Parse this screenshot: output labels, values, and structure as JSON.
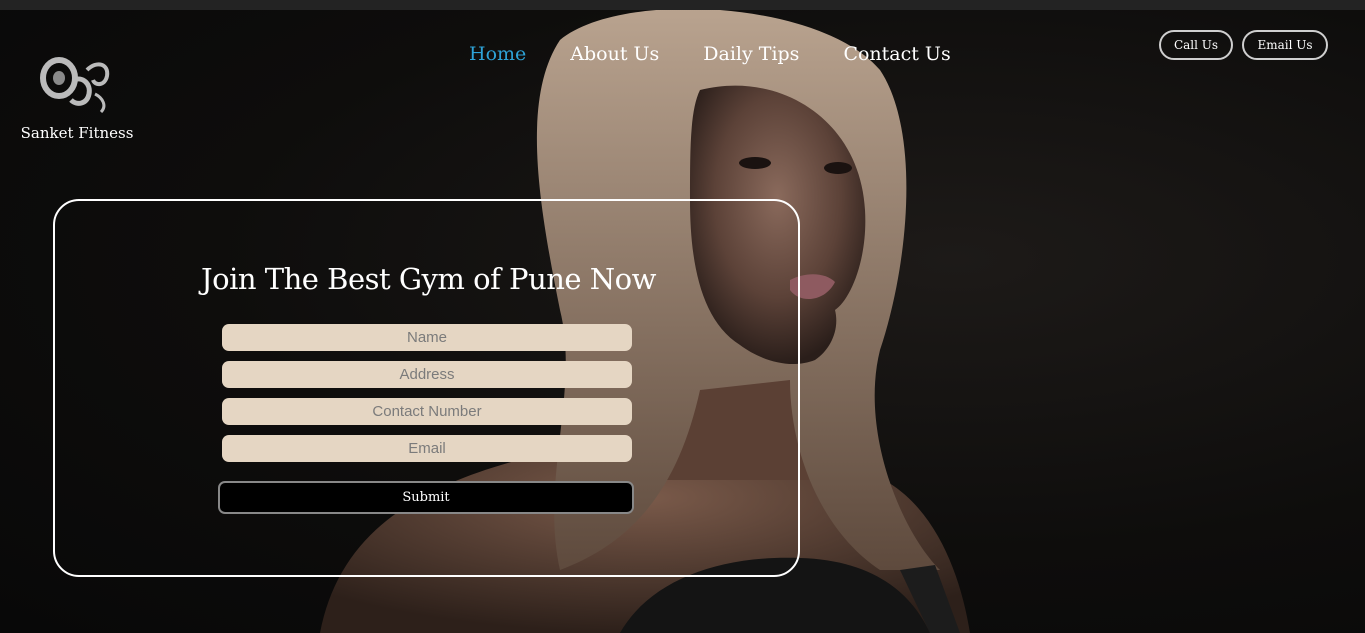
{
  "brand": {
    "name": "Sanket Fitness",
    "logo_icon": "dumbbell-bird-logo-icon"
  },
  "nav": {
    "items": [
      {
        "label": "Home",
        "active": true
      },
      {
        "label": "About Us",
        "active": false
      },
      {
        "label": "Daily Tips",
        "active": false
      },
      {
        "label": "Contact Us",
        "active": false
      }
    ]
  },
  "header_buttons": {
    "call": "Call Us",
    "email": "Email Us"
  },
  "form": {
    "title": "Join The Best Gym of Pune Now",
    "fields": {
      "name": "Name",
      "address": "Address",
      "contact": "Contact Number",
      "email": "Email"
    },
    "submit_label": "Submit"
  },
  "colors": {
    "active_link": "#2ea2d6",
    "field_bg": "#e5d6c3",
    "background": "#0c0c0c"
  }
}
